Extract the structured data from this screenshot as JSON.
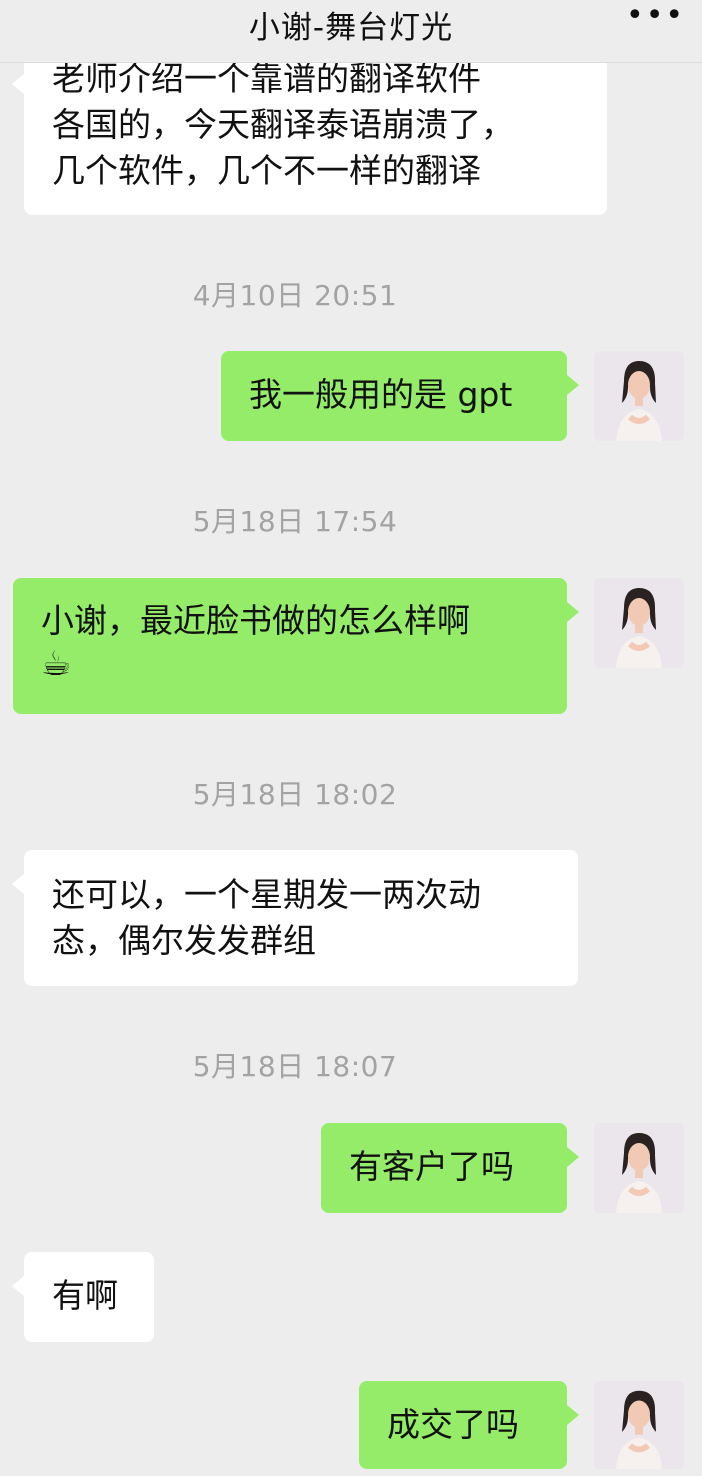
{
  "header": {
    "title": "小谢-舞台灯光",
    "more_icon": "more-horizontal-icon",
    "more_glyph": "•••"
  },
  "messages": [
    {
      "type": "text",
      "from": "contact",
      "lines": [
        "老师介绍一个靠谱的翻译软件",
        "各国的，今天翻译泰语崩溃了，",
        "几个软件，几个不一样的翻译"
      ]
    },
    {
      "type": "time",
      "text": "4月10日 20:51"
    },
    {
      "type": "text",
      "from": "me",
      "lines": [
        "我一般用的是 gpt"
      ]
    },
    {
      "type": "time",
      "text": "5月18日 17:54"
    },
    {
      "type": "text",
      "from": "me",
      "lines": [
        "小谢，最近脸书做的怎么样啊"
      ],
      "emoji": "☕",
      "emoji_name": "coffee-emoji"
    },
    {
      "type": "time",
      "text": "5月18日 18:02"
    },
    {
      "type": "text",
      "from": "contact",
      "lines": [
        "还可以，一个星期发一两次动",
        "态，偶尔发发群组"
      ]
    },
    {
      "type": "time",
      "text": "5月18日 18:07"
    },
    {
      "type": "text",
      "from": "me",
      "lines": [
        "有客户了吗"
      ]
    },
    {
      "type": "text",
      "from": "contact",
      "lines": [
        "有啊"
      ]
    },
    {
      "type": "text",
      "from": "me",
      "lines": [
        "成交了吗"
      ]
    }
  ],
  "colors": {
    "background": "#ededed",
    "outgoing_bubble": "#95ec69",
    "incoming_bubble": "#ffffff",
    "timestamp_text": "#a3a3a3"
  }
}
